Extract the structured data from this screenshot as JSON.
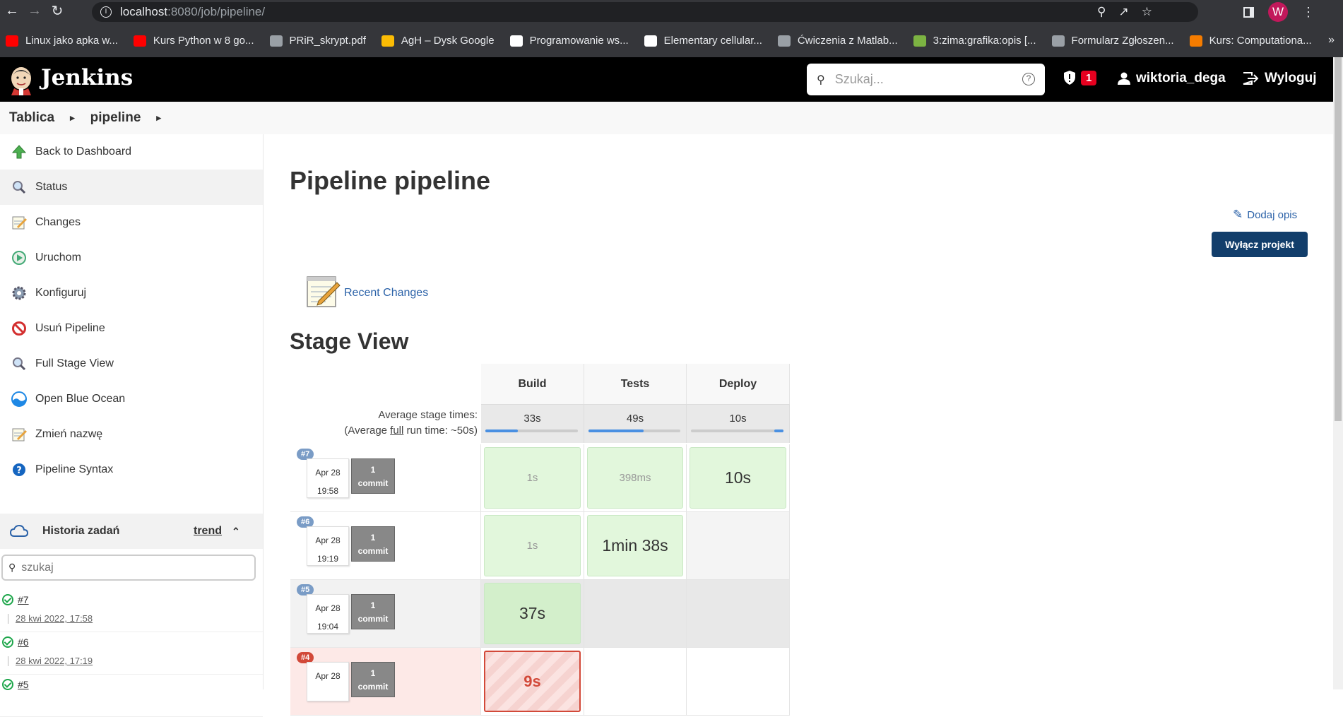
{
  "browser": {
    "url_host": "localhost",
    "url_rest": ":8080/job/pipeline/",
    "avatar_letter": "W",
    "bookmarks": [
      {
        "label": "Linux jako apka w...",
        "color": "#ff0000"
      },
      {
        "label": "Kurs Python w 8 go...",
        "color": "#ff0000"
      },
      {
        "label": "PRiR_skrypt.pdf",
        "color": "#9aa0a6"
      },
      {
        "label": "AgH – Dysk Google",
        "color": "#fbbc04"
      },
      {
        "label": "Programowanie ws...",
        "color": "#ffffff"
      },
      {
        "label": "Elementary cellular...",
        "color": "#ffffff"
      },
      {
        "label": "Ćwiczenia z Matlab...",
        "color": "#9aa0a6"
      },
      {
        "label": "3:zima:grafika:opis [...",
        "color": "#7cb342"
      },
      {
        "label": "Formularz Zgłoszen...",
        "color": "#9aa0a6"
      },
      {
        "label": "Kurs: Computationa...",
        "color": "#f57c00"
      }
    ]
  },
  "header": {
    "title": "Jenkins",
    "search_placeholder": "Szukaj...",
    "alerts_count": "1",
    "user": "wiktoria_dega",
    "logout": "Wyloguj"
  },
  "breadcrumbs": [
    "Tablica",
    "pipeline"
  ],
  "sidebar": {
    "items": [
      {
        "label": "Back to Dashboard",
        "icon": "up-arrow-icon"
      },
      {
        "label": "Status",
        "icon": "magnifier-icon"
      },
      {
        "label": "Changes",
        "icon": "notepad-icon"
      },
      {
        "label": "Uruchom",
        "icon": "clock-play-icon"
      },
      {
        "label": "Konfiguruj",
        "icon": "gear-icon"
      },
      {
        "label": "Usuń Pipeline",
        "icon": "no-entry-icon"
      },
      {
        "label": "Full Stage View",
        "icon": "magnifier-icon"
      },
      {
        "label": "Open Blue Ocean",
        "icon": "blue-ocean-icon"
      },
      {
        "label": "Zmień nazwę",
        "icon": "notepad-icon"
      },
      {
        "label": "Pipeline Syntax",
        "icon": "help-icon"
      }
    ],
    "history": {
      "title": "Historia zadań",
      "trend": "trend",
      "search_placeholder": "szukaj",
      "builds": [
        {
          "num": "#7",
          "date": "28 kwi 2022, 17:58"
        },
        {
          "num": "#6",
          "date": "28 kwi 2022, 17:19"
        },
        {
          "num": "#5",
          "date": ""
        }
      ]
    }
  },
  "main": {
    "title": "Pipeline pipeline",
    "add_description": "Dodaj opis",
    "disable_button": "Wyłącz projekt",
    "recent_changes": "Recent Changes",
    "stage_view_title": "Stage View",
    "avg_label_1": "Average stage times:",
    "avg_label_2_pre": "(Average ",
    "avg_label_2_full": "full",
    "avg_label_2_post": " run time: ~50s)",
    "stages": [
      {
        "name": "Build",
        "avg": "33s",
        "progress": 0.35
      },
      {
        "name": "Tests",
        "avg": "49s",
        "progress": 0.6
      },
      {
        "name": "Deploy",
        "avg": "10s",
        "progress": 0.1
      }
    ],
    "builds": [
      {
        "num": "#7",
        "date": "Apr 28",
        "time": "19:58",
        "commits": "1",
        "commit_word": "commit",
        "status": "success",
        "cells": [
          {
            "text": "1s",
            "style": "small"
          },
          {
            "text": "398ms",
            "style": "small"
          },
          {
            "text": "10s",
            "style": "big"
          }
        ]
      },
      {
        "num": "#6",
        "date": "Apr 28",
        "time": "19:19",
        "commits": "1",
        "commit_word": "commit",
        "status": "success",
        "cells": [
          {
            "text": "1s",
            "style": "small"
          },
          {
            "text": "1min 38s",
            "style": "big"
          },
          {
            "text": "",
            "style": "empty"
          }
        ]
      },
      {
        "num": "#5",
        "date": "Apr 28",
        "time": "19:04",
        "commits": "1",
        "commit_word": "commit",
        "status": "success",
        "cells": [
          {
            "text": "37s",
            "style": "big-dark"
          },
          {
            "text": "",
            "style": "empty"
          },
          {
            "text": "",
            "style": "empty"
          }
        ]
      },
      {
        "num": "#4",
        "date": "Apr 28",
        "time": "",
        "commits": "1",
        "commit_word": "commit",
        "status": "failed",
        "cells": [
          {
            "text": "9s",
            "style": "fail"
          },
          {
            "text": "",
            "style": "empty"
          },
          {
            "text": "",
            "style": "empty"
          }
        ]
      }
    ]
  }
}
